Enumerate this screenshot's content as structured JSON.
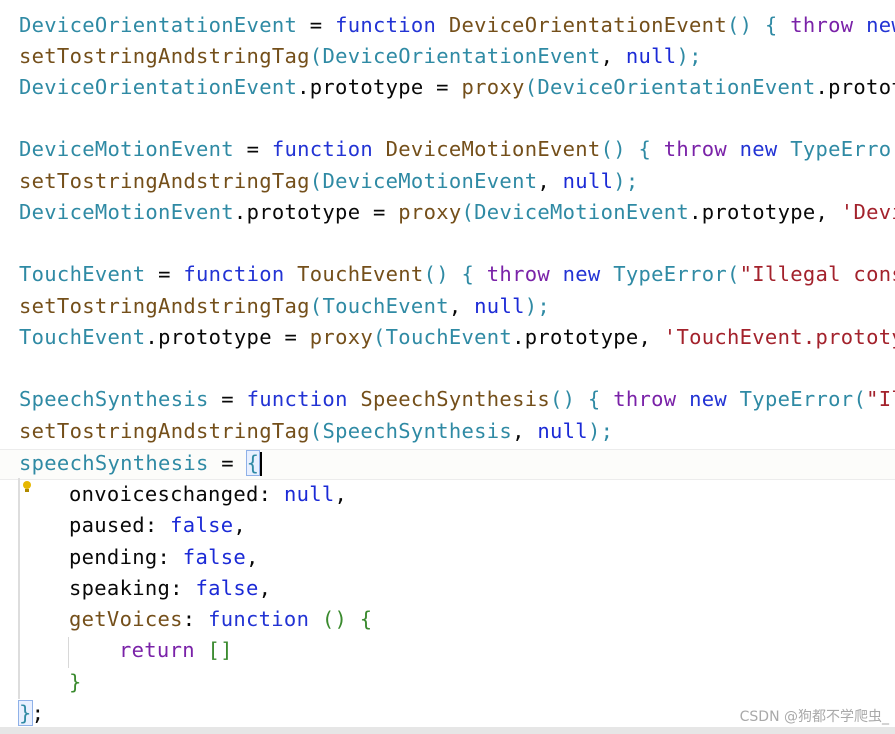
{
  "colors": {
    "identifier": "#2F8AA4",
    "keyword": "#2233D4",
    "function_name": "#744F1A",
    "throw": "#7A22A8",
    "string": "#A3222C",
    "plain": "#080808",
    "literal": "#1B2AD6",
    "brace": "#3A8A2E",
    "bulb": "#E6B700"
  },
  "code": {
    "l1": {
      "a": "DeviceOrientationEvent",
      "b": " = ",
      "c": "function",
      "d": " DeviceOrientationEvent",
      "e": "() {",
      "f": " throw",
      "g": " new"
    },
    "l2": {
      "a": "setTostringAndstringTag",
      "b": "(",
      "c": "DeviceOrientationEvent",
      "d": ", ",
      "e": "null",
      "f": ");"
    },
    "l3": {
      "a": "DeviceOrientationEvent",
      "b": ".prototype = ",
      "c": "proxy",
      "d": "(",
      "e": "DeviceOrientationEvent",
      "f": ".protot"
    },
    "l5": {
      "a": "DeviceMotionEvent",
      "b": " = ",
      "c": "function",
      "d": " DeviceMotionEvent",
      "e": "() {",
      "f": " throw",
      "g": " new",
      "h": " TypeError"
    },
    "l6": {
      "a": "setTostringAndstringTag",
      "b": "(",
      "c": "DeviceMotionEvent",
      "d": ", ",
      "e": "null",
      "f": ");"
    },
    "l7": {
      "a": "DeviceMotionEvent",
      "b": ".prototype = ",
      "c": "proxy",
      "d": "(",
      "e": "DeviceMotionEvent",
      "f": ".prototype, ",
      "g": "'Devi"
    },
    "l9": {
      "a": "TouchEvent",
      "b": " = ",
      "c": "function",
      "d": " TouchEvent",
      "e": "() {",
      "f": " throw",
      "g": " new",
      "h": " TypeError",
      "i": "(",
      "j": "\"Illegal cons"
    },
    "l10": {
      "a": "setTostringAndstringTag",
      "b": "(",
      "c": "TouchEvent",
      "d": ", ",
      "e": "null",
      "f": ");"
    },
    "l11": {
      "a": "TouchEvent",
      "b": ".prototype = ",
      "c": "proxy",
      "d": "(",
      "e": "TouchEvent",
      "f": ".prototype, ",
      "g": "'TouchEvent.prototy"
    },
    "l13": {
      "a": "SpeechSynthesis",
      "b": " = ",
      "c": "function",
      "d": " SpeechSynthesis",
      "e": "() {",
      "f": " throw",
      "g": " new",
      "h": " TypeError",
      "i": "(",
      "j": "\"Il"
    },
    "l14": {
      "a": "setTostringAndstringTag",
      "b": "(",
      "c": "SpeechSynthesis",
      "d": ", ",
      "e": "null",
      "f": ");"
    },
    "l15": {
      "a": "speechSynthesis",
      "b": " = ",
      "c": "{"
    },
    "l16": {
      "a": "onvoiceschanged",
      "b": ": ",
      "c": "null",
      "d": ","
    },
    "l17": {
      "a": "paused",
      "b": ": ",
      "c": "false",
      "d": ","
    },
    "l18": {
      "a": "pending",
      "b": ": ",
      "c": "false",
      "d": ","
    },
    "l19": {
      "a": "speaking",
      "b": ": ",
      "c": "false",
      "d": ","
    },
    "l20": {
      "a": "getVoices",
      "b": ": ",
      "c": "function",
      "d": " () {"
    },
    "l21": {
      "a": "return",
      "b": " []"
    },
    "l22": {
      "a": "}"
    },
    "l23": {
      "a": "}",
      "b": ";"
    }
  },
  "watermark": "CSDN @狗都不学爬虫_",
  "icons": {
    "intention": "lightbulb-icon"
  }
}
